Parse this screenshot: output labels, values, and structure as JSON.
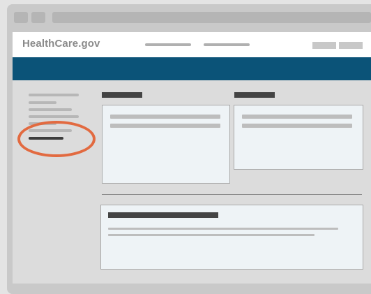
{
  "site": {
    "logo_text": "HealthCare.gov"
  },
  "colors": {
    "brand_band": "#0b5378",
    "highlight_ring": "#e26a40",
    "card_background": "#eef3f6"
  },
  "sidebar": {
    "active_item_highlighted": true
  }
}
